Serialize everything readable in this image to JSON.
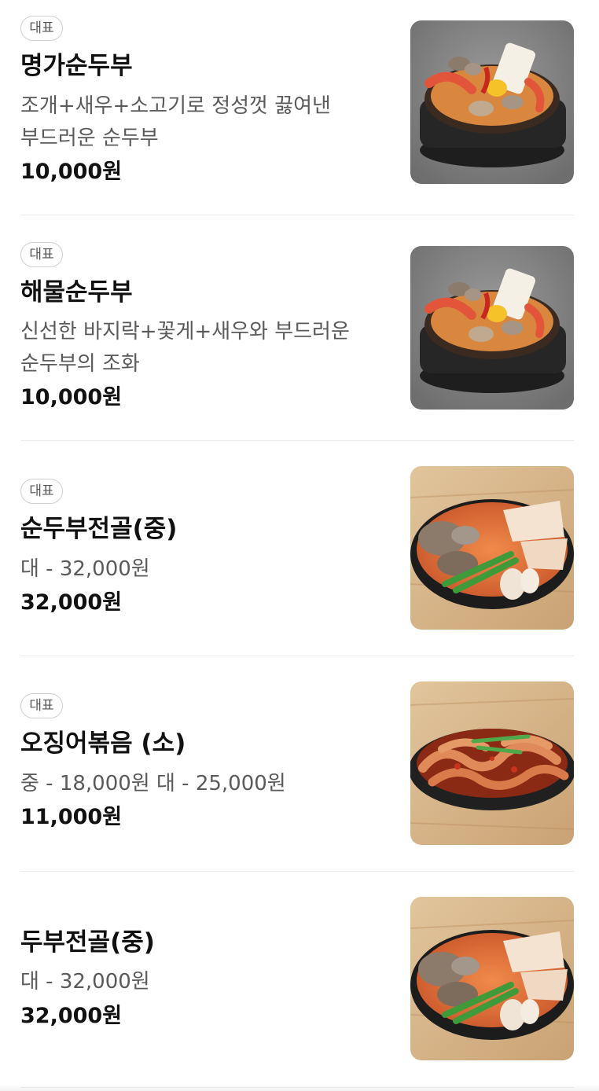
{
  "menu": {
    "items": [
      {
        "badge": "대표",
        "name": "명가순두부",
        "description": "조개+새우+소고기로 정성껏 끓여낸 부드러운 순두부",
        "price": "10,000원",
        "image": "soft-tofu-stew-photo"
      },
      {
        "badge": "대표",
        "name": "해물순두부",
        "description": "신선한 바지락+꽃게+새우와 부드러운 순두부의 조화",
        "price": "10,000원",
        "image": "seafood-tofu-stew-photo"
      },
      {
        "badge": "대표",
        "name": "순두부전골(중)",
        "description": "대 - 32,000원",
        "price": "32,000원",
        "image": "tofu-hotpot-photo"
      },
      {
        "badge": "대표",
        "name": "오징어볶음 (소)",
        "description": "중 - 18,000원 대 - 25,000원",
        "price": "11,000원",
        "image": "stir-fried-squid-photo"
      },
      {
        "badge": "",
        "name": "두부전골(중)",
        "description": "대 - 32,000원",
        "price": "32,000원",
        "image": "tofu-hotpot-photo"
      }
    ]
  },
  "colors": {
    "text_primary": "#111111",
    "text_secondary": "#5a5a5a",
    "badge_border": "#cfcfcf",
    "divider": "#ececec"
  }
}
